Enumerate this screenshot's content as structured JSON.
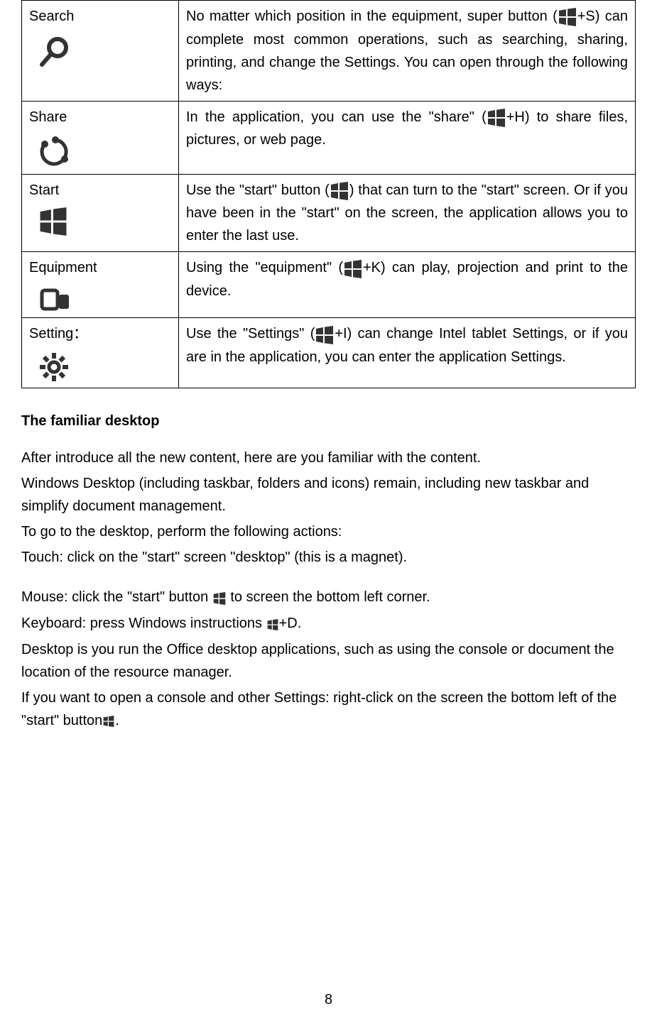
{
  "table": {
    "rows": [
      {
        "label": "Search",
        "desc_before": "No matter which position in the equipment, super button (",
        "shortcut": "+S)",
        "desc_after": " can complete most common operations, such as searching, sharing, printing, and change the Settings. You can open  through the following ways:"
      },
      {
        "label": "Share",
        "desc_before": "In the application, you can use the \"share\"   (",
        "shortcut": "+H)",
        "desc_after": " to share files, pictures, or web page."
      },
      {
        "label": "Start",
        "desc_before": "Use the \"start\" button (",
        "shortcut": ")",
        "desc_after": " that can turn to the \"start\" screen. Or if you have been in the \"start\" on the screen, the application allows you to enter the last use."
      },
      {
        "label": "Equipment",
        "desc_before": "Using the \"equipment\"   (",
        "shortcut": "+K)",
        "desc_after": " can play, projection and print to the device."
      },
      {
        "label": "Setting：",
        "desc_before": "Use the \"Settings\"   (",
        "shortcut": "+I)",
        "desc_after": " can change Intel tablet Settings, or if you are in the application, you can enter the application Settings."
      }
    ]
  },
  "section_heading": "The familiar desktop",
  "body": {
    "p1": "After introduce all the new content, here are you familiar with the content.",
    "p2": "Windows Desktop (including taskbar, folders and icons) remain, including new taskbar and simplify document management.",
    "p3": "To go to the desktop, perform the following actions:",
    "p4": "Touch: click on the \"start\" screen \"desktop\" (this is a magnet).",
    "p5a": "Mouse: click the \"start\" button ",
    "p5b": " to screen the bottom left corner.",
    "p6a": "Keyboard: press Windows instructions ",
    "p6b": "+D.",
    "p7": "Desktop is you run the Office desktop applications, such as using the console or document the location of the resource manager.",
    "p8a": "If you want to open a console and other Settings: right-click on the screen the bottom left of the \"start\" button",
    "p8b": "."
  },
  "page_number": "8"
}
